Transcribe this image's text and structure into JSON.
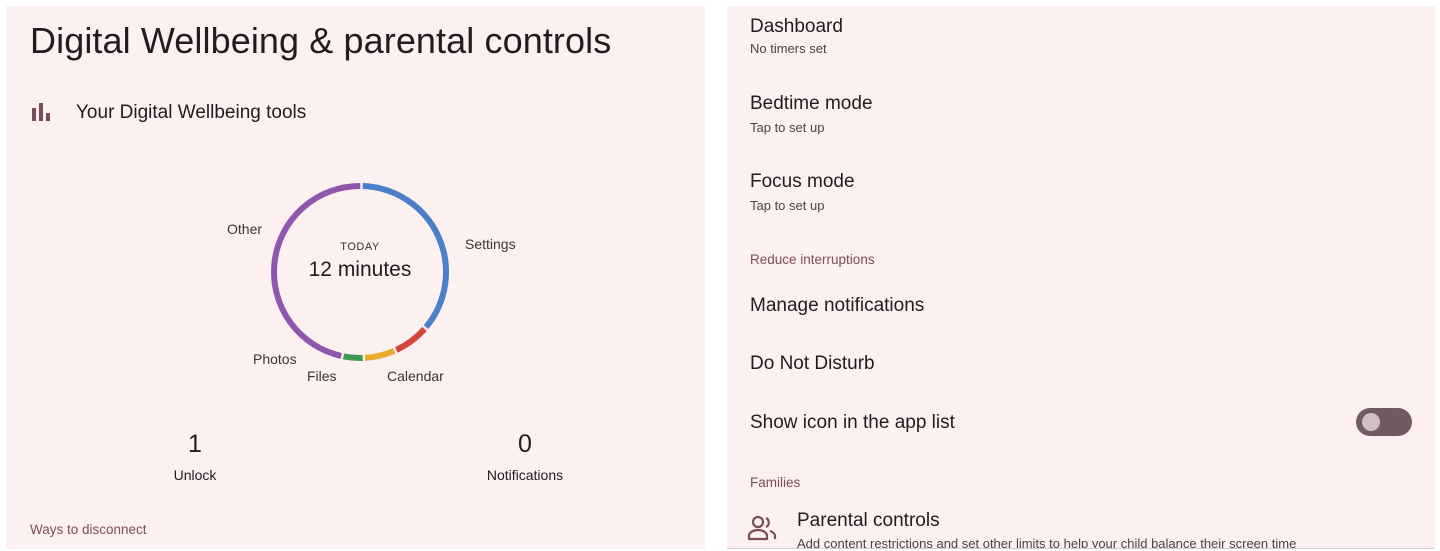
{
  "left": {
    "title": "Digital Wellbeing & parental controls",
    "tools_label": "Your Digital Wellbeing tools",
    "tools_icon": "bar-chart-icon",
    "chart_center": {
      "caption": "TODAY",
      "total": "12 minutes"
    },
    "chart_labels": {
      "other": "Other",
      "settings": "Settings",
      "photos": "Photos",
      "files": "Files",
      "calendar": "Calendar"
    },
    "stats": {
      "unlocks_value": "1",
      "unlocks_label": "Unlock",
      "notifications_value": "0",
      "notifications_label": "Notifications"
    },
    "ways_header": "Ways to disconnect"
  },
  "chart_data": {
    "type": "pie",
    "title": "",
    "center_label": "TODAY",
    "center_value": "12 minutes",
    "categories": [
      "Settings",
      "Calendar",
      "Files",
      "Photos",
      "Other"
    ],
    "values": [
      36,
      7,
      6,
      4,
      47
    ],
    "colors": [
      "#4a7fc9",
      "#d2453f",
      "#e8ad2e",
      "#3a9a56",
      "#8e57ac"
    ]
  },
  "right": {
    "dashboard": {
      "title": "Dashboard",
      "subtitle": "No timers set"
    },
    "bedtime": {
      "title": "Bedtime mode",
      "subtitle": "Tap to set up"
    },
    "focus": {
      "title": "Focus mode",
      "subtitle": "Tap to set up"
    },
    "reduce_header": "Reduce interruptions",
    "manage_notifications": "Manage notifications",
    "do_not_disturb": "Do Not Disturb",
    "show_icon": {
      "label": "Show icon in the app list",
      "enabled": false
    },
    "families_header": "Families",
    "parental": {
      "title": "Parental controls",
      "subtitle": "Add content restrictions and set other limits to help your child balance their screen time",
      "icon": "parental-controls-icon"
    }
  },
  "colors": {
    "background": "#fdf0f1",
    "accent": "#7d4c5a"
  }
}
